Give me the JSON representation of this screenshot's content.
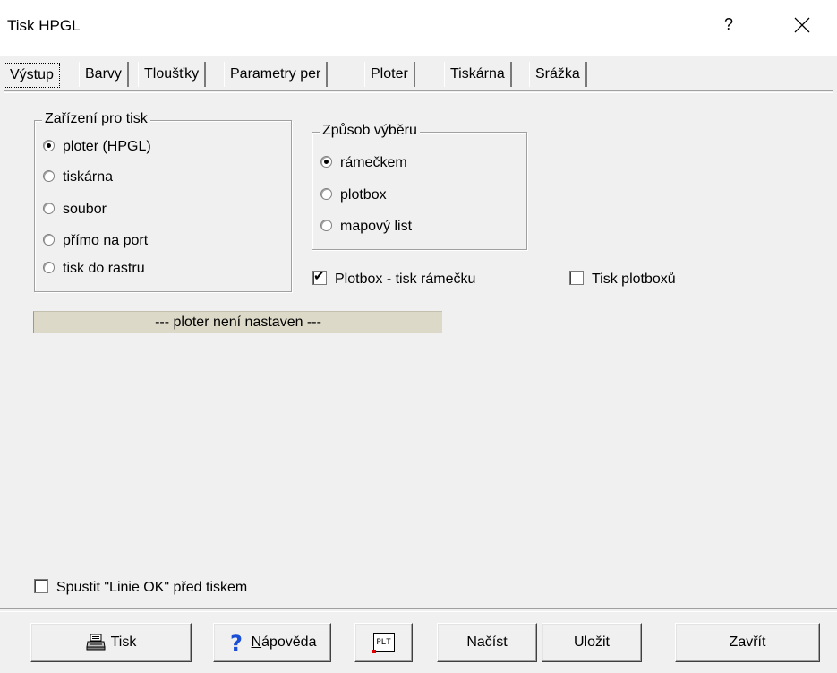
{
  "window": {
    "title": "Tisk HPGL",
    "help_glyph": "?",
    "close_glyph": "✕"
  },
  "tabs": [
    {
      "label": "Výstup",
      "active": true
    },
    {
      "label": "Barvy"
    },
    {
      "label": "Tloušťky"
    },
    {
      "label": "Parametry per"
    },
    {
      "label": "Ploter"
    },
    {
      "label": "Tiskárna"
    },
    {
      "label": "Srážka"
    }
  ],
  "device_group": {
    "legend": "Zařízení pro tisk",
    "options": [
      "ploter (HPGL)",
      "tiskárna",
      "soubor",
      "přímo na port",
      "tisk do rastru"
    ],
    "selected": "ploter (HPGL)"
  },
  "selection_group": {
    "legend": "Způsob výběru",
    "options": [
      "rámečkem",
      "plotbox",
      "mapový list"
    ],
    "selected": "rámečkem"
  },
  "checks": {
    "plotbox_frame": {
      "label": "Plotbox - tisk rámečku",
      "checked": true
    },
    "print_plotboxes": {
      "label": "Tisk plotboxů",
      "checked": false
    },
    "run_lines_ok": {
      "label": "Spustit \"Linie OK\" před tiskem",
      "checked": false
    }
  },
  "status": "--- ploter není nastaven ---",
  "buttons": {
    "print": "Tisk",
    "help_prefix": "N",
    "help_rest": "ápověda",
    "plt_icon": "PLT",
    "load": "Načíst",
    "save": "Uložit",
    "close": "Zavřít"
  },
  "colors": {
    "status_bg": "#ddd9c8",
    "help_icon": "#1a4fd6"
  }
}
